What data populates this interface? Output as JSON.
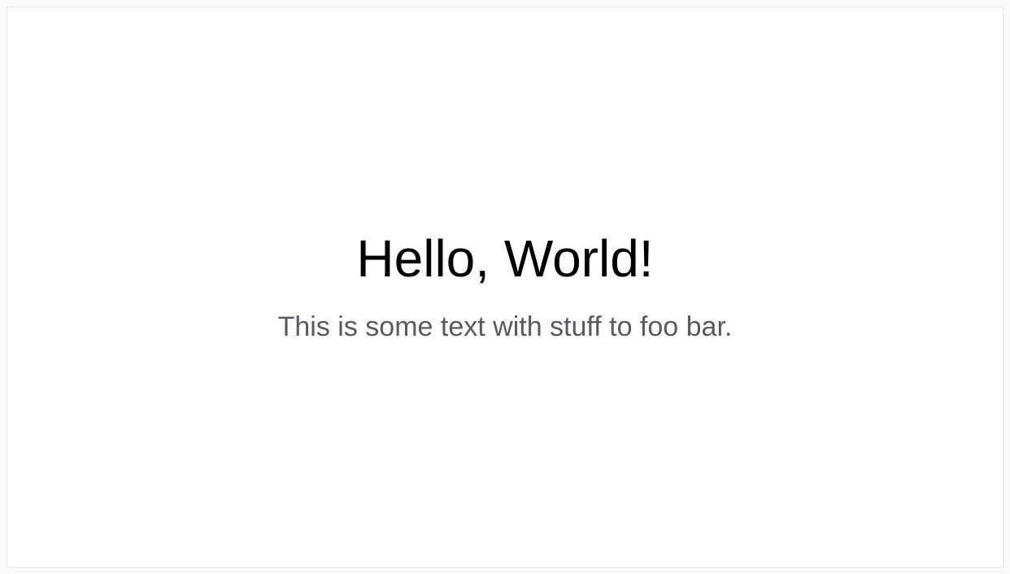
{
  "content": {
    "heading": "Hello, World!",
    "subtext": "This is some text with stuff to foo bar."
  }
}
